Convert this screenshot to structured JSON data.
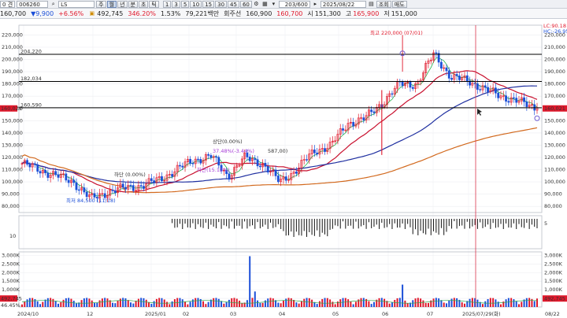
{
  "toolbar_top": {
    "timeframe": "0",
    "timeframe_unit": "견",
    "stock_code": "006260",
    "stock_name": "LS",
    "chart_types": [
      "주",
      "월",
      "년",
      "분",
      "초",
      "틱"
    ],
    "intervals": [
      "1",
      "3",
      "5",
      "10",
      "15",
      "30",
      "45",
      "60"
    ],
    "period_count": "203/600",
    "date": "2025/08/22",
    "query_button": "조회",
    "sell_button": "매도"
  },
  "quote_row": {
    "price": "160,700",
    "change_arrow": "▼",
    "change": "9,900",
    "change_pct": "+6.56%",
    "volume": "492,745",
    "volume_ratio": "346.20%",
    "turnover_pct": "1.53%",
    "amount_label": "79,221백만",
    "ratio_label": "회주선",
    "prev": "160,900",
    "open": "160,700",
    "high_label": "시",
    "high": "151,300",
    "low_label": "고",
    "low": "165,900",
    "close_label": "저",
    "close": "151,000"
  },
  "legend": {
    "lc": "LC:90.18",
    "hc": "HC:-26.95"
  },
  "price_axis": {
    "left": [
      "220,000",
      "210,000",
      "200,000",
      "190,000",
      "180,000",
      "170,000",
      "160,000",
      "150,000",
      "140,000",
      "130,000",
      "120,000",
      "110,000",
      "100,000",
      "90,000",
      "80,000"
    ],
    "right": [
      "220,000",
      "210,000",
      "200,000",
      "190,000",
      "180,000",
      "170,000",
      "160,000",
      "150,000",
      "140,000",
      "130,000",
      "120,000",
      "110,000",
      "100,000",
      "90,000",
      "80,000"
    ]
  },
  "levels": [
    {
      "label": "204,220",
      "value": 204220,
      "color": "#000000"
    },
    {
      "label": "182,034",
      "value": 182034,
      "color": "#000000"
    },
    {
      "label": "160,590",
      "value": 160590,
      "color": "#000000"
    }
  ],
  "current_left": "160,021",
  "current_right": "160,021",
  "annotations": {
    "high": "최고 220,000 (07/01)",
    "low": "최저 84,500 (11/18)",
    "a1": "상단(0.00%)",
    "a2": "하단 (0.00%)",
    "a3": "37.48%(-3.44%)",
    "a4": "하단(15.12%)",
    "a5": "587,00)"
  },
  "osc_axis": {
    "left": "10",
    "right": "5"
  },
  "volume_axis": {
    "left": [
      "3,000K",
      "2,500K",
      "2,000K",
      "1,500K",
      "1,000K",
      "500K"
    ],
    "right": [
      "3,000K",
      "2,500K",
      "2,000K",
      "1,500K",
      "1,000K",
      "500K"
    ],
    "current_left": "492,745",
    "current_sub": "46.45%",
    "current_right": "492,745"
  },
  "x_axis": {
    "labels": [
      "2024/10",
      "12",
      "2025/01",
      "02",
      "03",
      "04",
      "05",
      "06",
      "07",
      "2025/07/29(화)",
      "08/22"
    ]
  },
  "colors": {
    "up": "#e0182b",
    "down": "#1b4fd8",
    "ma5": "#22b14c",
    "ma20": "#c8102e",
    "ma60": "#1f2fa0",
    "ma120": "#d2691e",
    "cursor": "#d9344e"
  },
  "chart_data": {
    "type": "candlestick",
    "symbol": "LS",
    "x": [
      "2024/10",
      "12",
      "2025/01",
      "02",
      "03",
      "04",
      "05",
      "06",
      "07",
      "08/22"
    ],
    "close_path": [
      [
        "2024/10",
        115000
      ],
      [
        "2024/10",
        110000
      ],
      [
        "2024/10",
        105000
      ],
      [
        "11",
        100000
      ],
      [
        "11",
        86000
      ],
      [
        "12",
        92000
      ],
      [
        "12",
        95000
      ],
      [
        "2025/01",
        97000
      ],
      [
        "2025/01",
        102000
      ],
      [
        "02",
        110000
      ],
      [
        "02",
        118000
      ],
      [
        "02",
        121000
      ],
      [
        "03",
        105000
      ],
      [
        "03",
        120000
      ],
      [
        "03",
        115000
      ],
      [
        "04",
        100000
      ],
      [
        "04",
        110000
      ],
      [
        "04",
        125000
      ],
      [
        "05",
        130000
      ],
      [
        "05",
        148000
      ],
      [
        "05",
        152000
      ],
      [
        "06",
        165000
      ],
      [
        "06",
        180000
      ],
      [
        "06",
        180000
      ],
      [
        "07",
        205000
      ],
      [
        "07",
        185000
      ],
      [
        "07",
        183000
      ],
      [
        "07",
        175000
      ],
      [
        "08",
        170000
      ],
      [
        "08",
        165000
      ],
      [
        "08/22",
        160700
      ]
    ],
    "high": 220000,
    "low": 84500,
    "ylim": [
      75000,
      228000
    ]
  }
}
